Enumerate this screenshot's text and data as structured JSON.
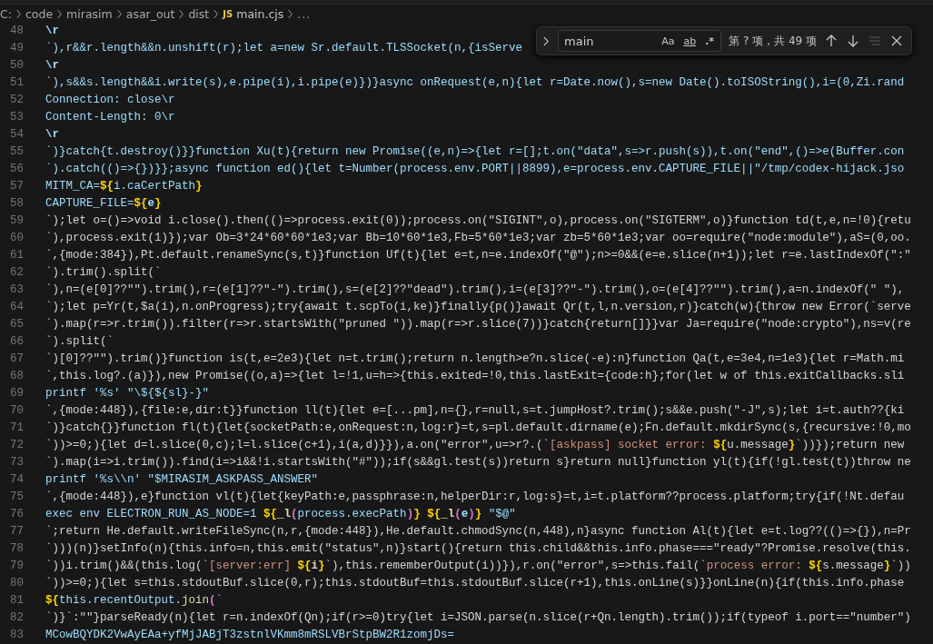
{
  "breadcrumb": [
    {
      "label": "C:",
      "kind": "folder"
    },
    {
      "label": "code",
      "kind": "folder"
    },
    {
      "label": "mirasim",
      "kind": "folder"
    },
    {
      "label": "asar_out",
      "kind": "folder"
    },
    {
      "label": "dist",
      "kind": "folder"
    },
    {
      "label": "main.cjs",
      "kind": "file",
      "badge": "JS"
    },
    {
      "label": "...",
      "kind": "more"
    }
  ],
  "editor": {
    "lines": [
      {
        "number": "48",
        "segments": [
          {
            "text": "\\r",
            "color": "#9cdcfe"
          }
        ]
      },
      {
        "number": "49",
        "segments": [
          {
            "text": "`),r&&r.length&&n.unshift(r);let a=new Sr.default.TLSSocket(n,{isServe",
            "color": "#9cdcfe"
          }
        ]
      },
      {
        "number": "50",
        "segments": [
          {
            "text": "\\r",
            "color": "#9cdcfe"
          }
        ]
      },
      {
        "number": "51",
        "segments": [
          {
            "text": "`),s&&s.length&&i.write(s),e.pipe(i),i.pipe(e)})}async onRequest(e,n){let r=Date.now(),s=new Date().toISOString(),i=(0,Zi.rand",
            "color": "#9cdcfe"
          }
        ]
      },
      {
        "number": "52",
        "segments": [
          {
            "text": "Connection: close\\r",
            "color": "#9cdcfe"
          }
        ]
      },
      {
        "number": "53",
        "segments": [
          {
            "text": "Content-Length: 0\\r",
            "color": "#9cdcfe"
          }
        ]
      },
      {
        "number": "54",
        "segments": [
          {
            "text": "\\r",
            "color": "#9cdcfe"
          }
        ]
      },
      {
        "number": "55",
        "segments": [
          {
            "text": "`)}catch{t.destroy()}}function Xu(t){return new Promise((e,n)=>{let r=[];t.on(\"data\",s=>r.push(s)),t.on(\"end\",()=>e(Buffer.con",
            "color": "#9cdcfe"
          }
        ]
      },
      {
        "number": "56",
        "segments": [
          {
            "text": "`).catch(()=>{})}};async function ed(){let t=Number(process.env.PORT||8899),e=process.env.CAPTURE_FILE||\"/tmp/codex-hijack.jso",
            "color": "#9cdcfe"
          }
        ]
      },
      {
        "number": "57",
        "segments": [
          {
            "text": "MITM_CA=",
            "color": "#9cdcfe"
          },
          {
            "text": "${",
            "color": "#ffd700"
          },
          {
            "text": "i.caCertPath",
            "color": "#9cdcfe"
          },
          {
            "text": "}",
            "color": "#ffd700"
          }
        ]
      },
      {
        "number": "58",
        "segments": [
          {
            "text": "CAPTURE_FILE=",
            "color": "#9cdcfe"
          },
          {
            "text": "${",
            "color": "#ffd700"
          },
          {
            "text": "e",
            "color": "#9cdcfe"
          },
          {
            "text": "}",
            "color": "#ffd700"
          }
        ]
      },
      {
        "number": "59",
        "segments": [
          {
            "text": "`);let o=()=>void i.close().then(()=>process.exit(0));process.on(\"SIGINT\",o),process.on(\"SIGTERM\",o)}function td(t,e,n=!0){retu",
            "color": "#d4d4d4"
          }
        ]
      },
      {
        "number": "60",
        "segments": [
          {
            "text": "`),process.exit(1)});var Ob=3*24*60*60*1e3;var Bb=10*60*1e3,Fb=5*60*1e3;var zb=5*60*1e3;var oo=require(\"node:module\"),aS=(0,oo.",
            "color": "#d4d4d4"
          }
        ]
      },
      {
        "number": "61",
        "segments": [
          {
            "text": "`,{mode:384}),Pt.default.renameSync(s,t)}function Uf(t){let e=t,n=e.indexOf(\"@\");n>=0&&(e=e.slice(n+1));let r=e.lastIndexOf(\":\"",
            "color": "#d4d4d4"
          }
        ]
      },
      {
        "number": "62",
        "segments": [
          {
            "text": "`).trim().split(`",
            "color": "#d4d4d4"
          }
        ]
      },
      {
        "number": "63",
        "segments": [
          {
            "text": "`),n=(e[0]??\"\").trim(),r=(e[1]??\"-\").trim(),s=(e[2]??\"dead\").trim(),i=(e[3]??\"-\").trim(),o=(e[4]??\"\").trim(),a=n.indexOf(\" \"),",
            "color": "#d4d4d4"
          }
        ]
      },
      {
        "number": "64",
        "segments": [
          {
            "text": "`);let p=Yr(t,$a(i),n.onProgress);try{await t.scpTo(i,ke)}finally{p()}await Qr(t,l,n.version,r)}catch(w){throw new Error(`serve",
            "color": "#d4d4d4"
          }
        ]
      },
      {
        "number": "65",
        "segments": [
          {
            "text": "`).map(r=>r.trim()).filter(r=>r.startsWith(\"pruned \")).map(r=>r.slice(7))}catch{return[]}}var Ja=require(\"node:crypto\"),ns=v(re",
            "color": "#d4d4d4"
          }
        ]
      },
      {
        "number": "66",
        "segments": [
          {
            "text": "`).split(`",
            "color": "#d4d4d4"
          }
        ]
      },
      {
        "number": "67",
        "segments": [
          {
            "text": "`)[0]??\"\").trim()}function is(t,e=2e3){let n=t.trim();return n.length>e?n.slice(-e):n}function Qa(t,e=3e4,n=1e3){let r=Math.mi",
            "color": "#d4d4d4"
          }
        ]
      },
      {
        "number": "68",
        "segments": [
          {
            "text": "`,this.log?.(a)}),new Promise((o,a)=>{let l=!1,u=h=>{this.exited=!0,this.lastExit={code:h};for(let w of this.exitCallbacks.sli",
            "color": "#d4d4d4"
          }
        ]
      },
      {
        "number": "69",
        "segments": [
          {
            "text": "printf '%s' \"\\${${sl}-}\"",
            "color": "#9cdcfe"
          }
        ]
      },
      {
        "number": "70",
        "segments": [
          {
            "text": "`,{mode:448}),{file:e,dir:t}}function ll(t){let e=[...pm],n={},r=null,s=t.jumpHost?.trim();s&&e.push(\"-J\",s);let i=t.auth??{ki",
            "color": "#d4d4d4"
          }
        ]
      },
      {
        "number": "71",
        "segments": [
          {
            "text": "`)}catch{}}function fl(t){let{socketPath:e,onRequest:n,log:r}=t,s=pl.default.dirname(e);Fn.default.mkdirSync(s,{recursive:!0,mo",
            "color": "#d4d4d4"
          }
        ]
      },
      {
        "number": "72",
        "segments": [
          {
            "text": "`))>=0;){let d=l.slice(0,c);l=l.slice(c+1),i(a,d)}}),a.on(\"error\",u=>r?.(`",
            "color": "#d4d4d4"
          },
          {
            "text": "[askpass] socket error: ",
            "color": "#ce9178"
          },
          {
            "text": "${",
            "color": "#ffd700"
          },
          {
            "text": "u.message",
            "color": "#d4d4d4"
          },
          {
            "text": "}",
            "color": "#ffd700"
          },
          {
            "text": "`))});return new",
            "color": "#d4d4d4"
          }
        ]
      },
      {
        "number": "73",
        "segments": [
          {
            "text": "`).map(i=>i.trim()).find(i=>i&&!i.startsWith(\"#\"));if(s&&gl.test(s))return s}return null}function yl(t){if(!gl.test(t))throw ne",
            "color": "#d4d4d4"
          }
        ]
      },
      {
        "number": "74",
        "segments": [
          {
            "text": "printf '%s\\\\n' \"$MIRASIM_ASKPASS_ANSWER\"",
            "color": "#9cdcfe"
          }
        ]
      },
      {
        "number": "75",
        "segments": [
          {
            "text": "`,{mode:448}),e}function vl(t){let{keyPath:e,passphrase:n,helperDir:r,log:s}=t,i=t.platform??process.platform;try{if(!Nt.defau",
            "color": "#d4d4d4"
          }
        ]
      },
      {
        "number": "76",
        "segments": [
          {
            "text": "exec env ELECTRON_RUN_AS_NODE=1 ",
            "color": "#9cdcfe"
          },
          {
            "text": "${",
            "color": "#ffd700"
          },
          {
            "text": "_l",
            "color": "#dcdcaa"
          },
          {
            "text": "(",
            "color": "#da70d6"
          },
          {
            "text": "process.execPath",
            "color": "#9cdcfe"
          },
          {
            "text": ")",
            "color": "#da70d6"
          },
          {
            "text": "} ",
            "color": "#ffd700"
          },
          {
            "text": "${",
            "color": "#ffd700"
          },
          {
            "text": "_l",
            "color": "#dcdcaa"
          },
          {
            "text": "(",
            "color": "#da70d6"
          },
          {
            "text": "e",
            "color": "#9cdcfe"
          },
          {
            "text": ")",
            "color": "#da70d6"
          },
          {
            "text": "}",
            "color": "#ffd700"
          },
          {
            "text": " \"$@\"",
            "color": "#9cdcfe"
          }
        ]
      },
      {
        "number": "77",
        "segments": [
          {
            "text": "`;return He.default.writeFileSync(n,r,{mode:448}),He.default.chmodSync(n,448),n}async function Al(t){let e=t.log??(()=>{}),n=Pr",
            "color": "#d4d4d4"
          }
        ]
      },
      {
        "number": "78",
        "segments": [
          {
            "text": "`)))(n)}setInfo(n){this.info=n,this.emit(\"status\",n)}start(){return this.child&&this.info.phase===\"ready\"?Promise.resolve(this.",
            "color": "#d4d4d4"
          }
        ]
      },
      {
        "number": "79",
        "segments": [
          {
            "text": "`))i.trim()&&(this.log(`",
            "color": "#d4d4d4"
          },
          {
            "text": "[server:err] ",
            "color": "#ce9178"
          },
          {
            "text": "${",
            "color": "#ffd700"
          },
          {
            "text": "i",
            "color": "#d4d4d4"
          },
          {
            "text": "}",
            "color": "#ffd700"
          },
          {
            "text": "`),this.rememberOutput(i))}),r.on(\"error\",s=>this.fail(`",
            "color": "#d4d4d4"
          },
          {
            "text": "process error: ",
            "color": "#ce9178"
          },
          {
            "text": "${",
            "color": "#ffd700"
          },
          {
            "text": "s.message",
            "color": "#d4d4d4"
          },
          {
            "text": "}",
            "color": "#ffd700"
          },
          {
            "text": "`))",
            "color": "#d4d4d4"
          }
        ]
      },
      {
        "number": "80",
        "segments": [
          {
            "text": "`))>=0;){let s=this.stdoutBuf.slice(0,r);this.stdoutBuf=this.stdoutBuf.slice(r+1),this.onLine(s)}}onLine(n){if(this.info.phase",
            "color": "#d4d4d4"
          }
        ]
      },
      {
        "number": "81",
        "segments": [
          {
            "text": "${",
            "color": "#ffd700"
          },
          {
            "text": "this.recentOutput.",
            "color": "#9cdcfe"
          },
          {
            "text": "join",
            "color": "#dcdcaa"
          },
          {
            "text": "(`",
            "color": "#da70d6"
          }
        ]
      },
      {
        "number": "82",
        "segments": [
          {
            "text": "`)}`:\"\"}parseReady(n){let r=n.indexOf(Qn);if(r>=0)try{let i=JSON.parse(n.slice(r+Qn.length).trim());if(typeof i.port==\"number\")",
            "color": "#d4d4d4"
          }
        ]
      },
      {
        "number": "83",
        "segments": [
          {
            "text": "MCowBQYDK2VwAyEAa+yfMjJABjT3zstnlVKmm8mRSLVBrStpBW2R1zomjDs=",
            "color": "#9cdcfe"
          }
        ]
      }
    ]
  },
  "find_widget": {
    "expanded": false,
    "query": "main",
    "options": [
      {
        "label": "Aa",
        "kind": "case",
        "on": false
      },
      {
        "label": "ab",
        "kind": "word",
        "on": false
      },
      {
        "label": ".*",
        "kind": "regex",
        "on": false
      }
    ],
    "result": "第 ? 项，共 49 项",
    "find_in_selection": {
      "disabled": true
    }
  }
}
